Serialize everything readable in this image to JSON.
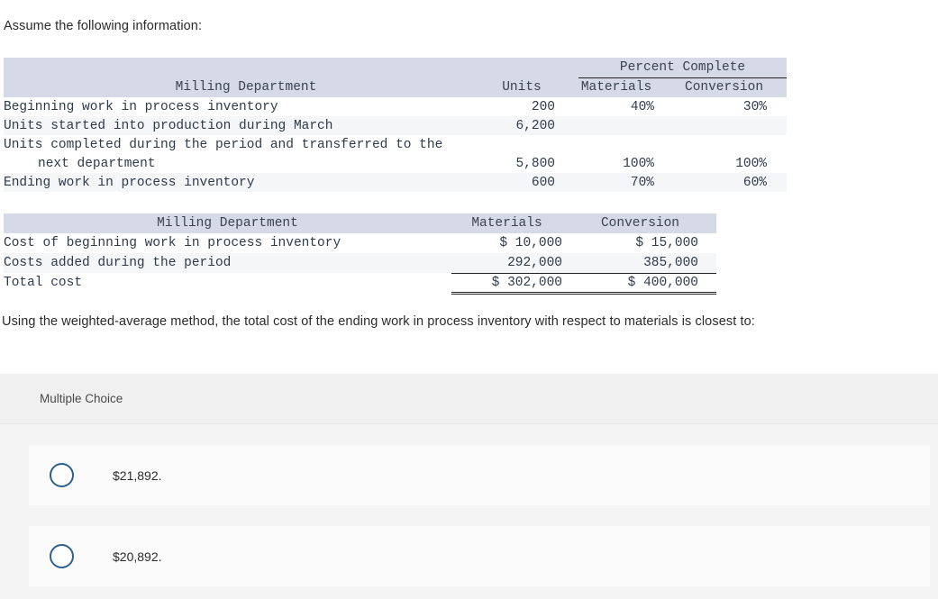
{
  "intro": "Assume the following information:",
  "units_table": {
    "span_header": "Percent Complete",
    "headers": {
      "department": "Milling Department",
      "units": "Units",
      "materials": "Materials",
      "conversion": "Conversion"
    },
    "rows": [
      {
        "label": "Beginning work in process inventory",
        "units": "200",
        "materials": "40%",
        "conversion": "30%"
      },
      {
        "label": "Units started into production during March",
        "units": "6,200",
        "materials": "",
        "conversion": ""
      },
      {
        "label": "Units completed during the period and transferred to the",
        "units": "",
        "materials": "",
        "conversion": ""
      },
      {
        "label": "next department",
        "units": "5,800",
        "materials": "100%",
        "conversion": "100%"
      },
      {
        "label": "Ending work in process inventory",
        "units": "600",
        "materials": "70%",
        "conversion": "60%"
      }
    ]
  },
  "cost_table": {
    "headers": {
      "department": "Milling Department",
      "materials": "Materials",
      "conversion": "Conversion"
    },
    "rows": [
      {
        "label": "Cost of beginning work in process inventory",
        "materials": "$ 10,000",
        "conversion": "$ 15,000"
      },
      {
        "label": "Costs added during the period",
        "materials": "292,000",
        "conversion": "385,000"
      },
      {
        "label": "Total cost",
        "materials": "$ 302,000",
        "conversion": "$ 400,000"
      }
    ]
  },
  "question": "Using the weighted-average method, the total cost of the ending work in process inventory with respect to materials is closest to:",
  "multiple_choice": {
    "label": "Multiple Choice",
    "options": [
      {
        "text": "$21,892."
      },
      {
        "text": "$20,892."
      }
    ]
  },
  "colors": {
    "header_band": "#d5dae6",
    "row_stripe": "#f5f6f7",
    "radio_border": "#2e5f8f",
    "panel_bg": "#f4f4f4",
    "panel_head_bg": "#f0f0f0",
    "option_bg": "#fafafa",
    "text": "#2b2b2b"
  }
}
